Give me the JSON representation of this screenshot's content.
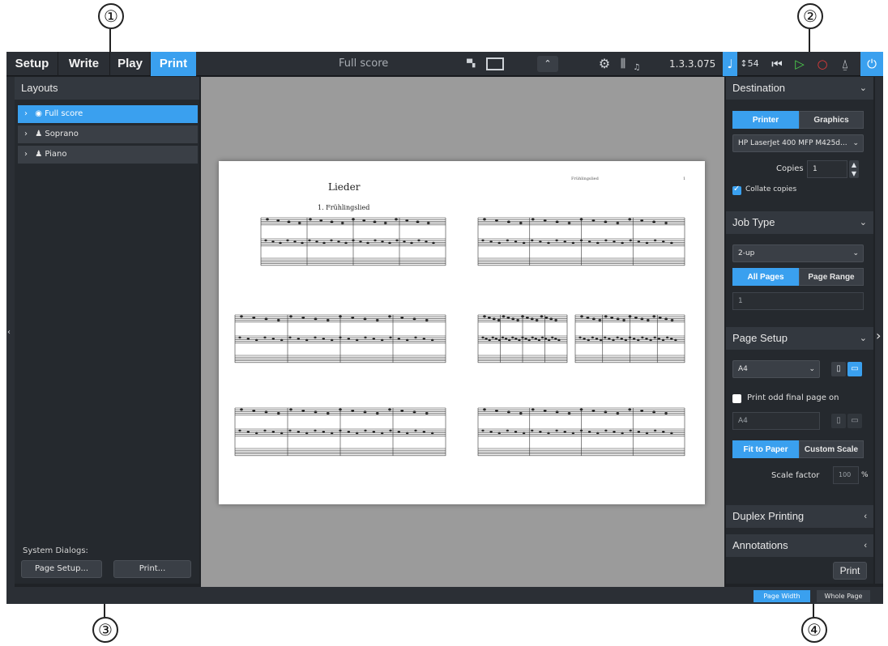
{
  "callouts": [
    "①",
    "②",
    "③",
    "④"
  ],
  "toolbar": {
    "modes": [
      "Setup",
      "Write",
      "Play",
      "Print"
    ],
    "active_mode": "Print",
    "document_title": "Full score",
    "version": "1.3.3.075",
    "tempo_value": "54"
  },
  "layouts_panel": {
    "title": "Layouts",
    "items": [
      {
        "label": "Full score",
        "icon": "full-score-icon",
        "active": true
      },
      {
        "label": "Soprano",
        "icon": "part-icon",
        "active": false
      },
      {
        "label": "Piano",
        "icon": "part-icon",
        "active": false
      }
    ],
    "system_dialogs_label": "System Dialogs:",
    "page_setup_button": "Page Setup...",
    "print_button": "Print..."
  },
  "score_page": {
    "title": "Lieder",
    "subtitle": "1. Frühlingslied",
    "header": "Frühlingslied",
    "page_number": "1"
  },
  "destination": {
    "title": "Destination",
    "tabs": [
      "Printer",
      "Graphics"
    ],
    "active_tab": "Printer",
    "printer_name": "HP LaserJet 400 MFP M425d...",
    "copies_label": "Copies",
    "copies_value": "1",
    "collate_label": "Collate copies",
    "collate_checked": true
  },
  "job_type": {
    "title": "Job Type",
    "selected": "2-up",
    "range_tabs": [
      "All Pages",
      "Page Range"
    ],
    "active_range": "All Pages",
    "range_value": "1"
  },
  "page_setup": {
    "title": "Page Setup",
    "paper_size": "A4",
    "print_odd_label": "Print odd final page on",
    "print_odd_checked": false,
    "odd_paper_size": "A4",
    "scale_tabs": [
      "Fit to Paper",
      "Custom Scale"
    ],
    "active_scale": "Fit to Paper",
    "scale_factor_label": "Scale factor",
    "scale_factor_value": "100",
    "scale_unit": "%"
  },
  "duplex": {
    "title": "Duplex Printing"
  },
  "annotations": {
    "title": "Annotations"
  },
  "print_action": "Print",
  "status_bar": {
    "views": [
      "Page Width",
      "Whole Page"
    ],
    "active_view": "Page Width"
  },
  "colors": {
    "accent": "#3aa0ef",
    "panel": "#25292e",
    "toolbar": "#2b2f35",
    "canvas": "#9b9b9b"
  }
}
